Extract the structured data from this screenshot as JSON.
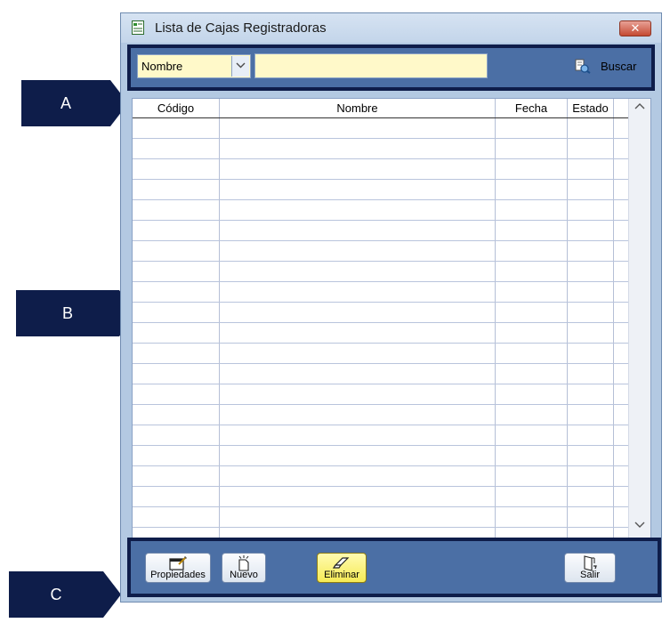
{
  "window": {
    "title": "Lista de Cajas Registradoras",
    "close_label": "✕",
    "icon": "document-list-icon"
  },
  "search": {
    "field_selected": "Nombre",
    "input_value": "",
    "button_label": "Buscar",
    "button_icon": "search-binoculars-icon"
  },
  "grid": {
    "columns": [
      "Código",
      "Nombre",
      "Fecha",
      "Estado"
    ],
    "rows": []
  },
  "toolbar": {
    "buttons": [
      {
        "label": "Propiedades",
        "icon": "properties-icon"
      },
      {
        "label": "Nuevo",
        "icon": "new-document-icon"
      },
      {
        "label": "Eliminar",
        "icon": "eraser-icon",
        "state": "highlighted"
      },
      {
        "label": "Salir",
        "icon": "exit-door-icon"
      }
    ]
  },
  "callouts": [
    "A",
    "B",
    "C"
  ],
  "colors": {
    "panel_blue": "#4b6fa5",
    "frame_navy": "#0e1d4a",
    "input_yellow": "#fff9c9",
    "highlight_yellow": "#f6ea55"
  }
}
